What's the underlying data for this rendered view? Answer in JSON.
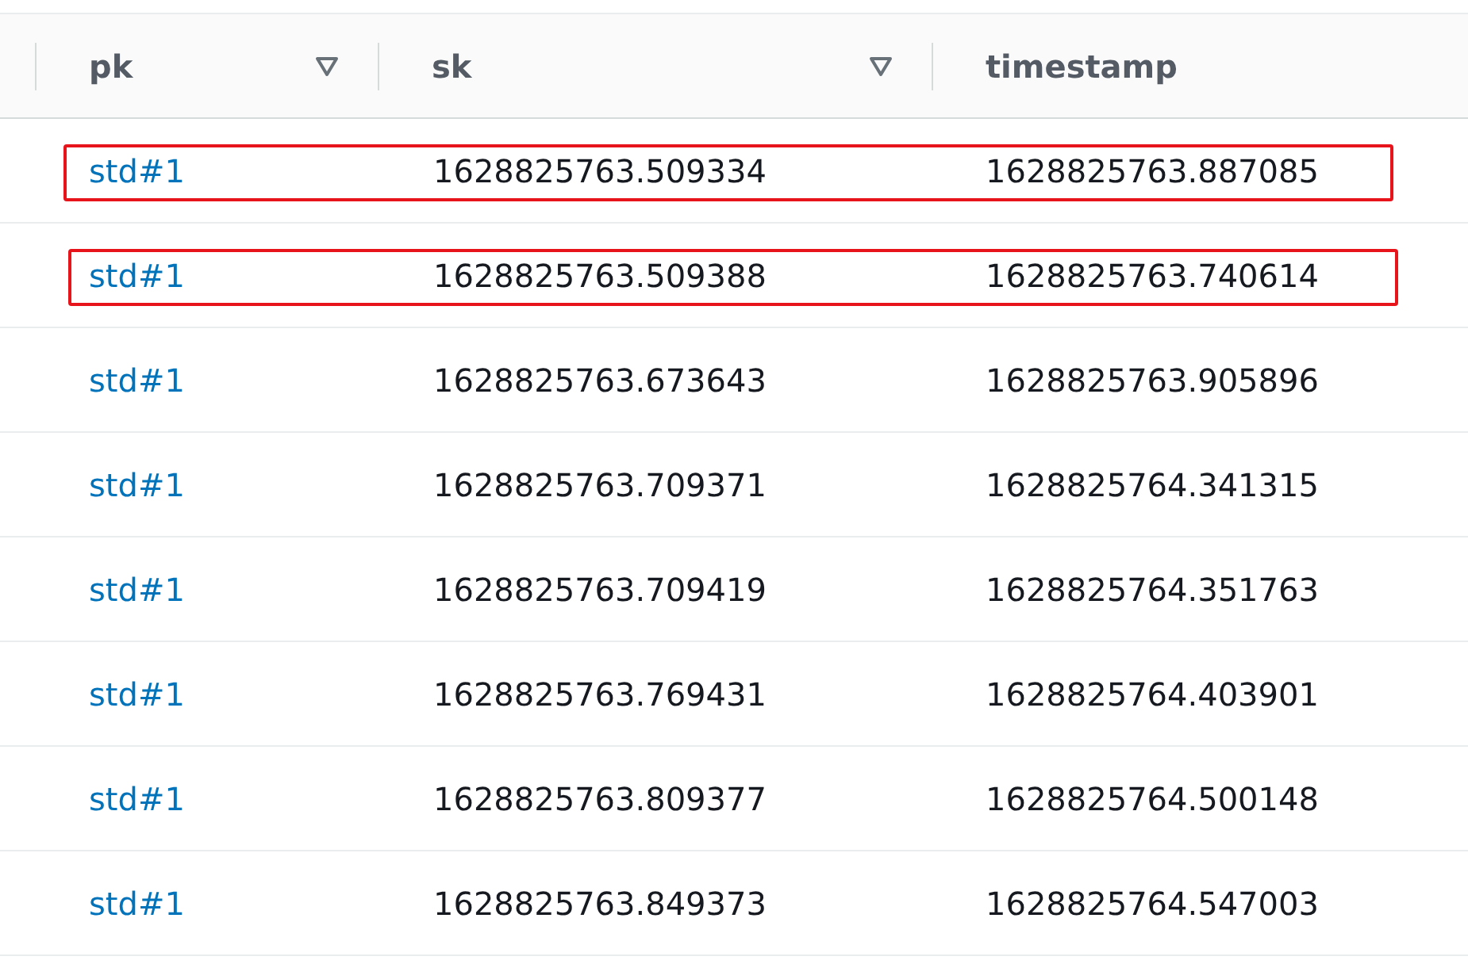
{
  "table": {
    "columns": [
      {
        "label": "pk",
        "sort_icon": true
      },
      {
        "label": "sk",
        "sort_icon": true
      },
      {
        "label": "timestamp",
        "sort_icon": false
      }
    ],
    "rows": [
      {
        "pk": "std#1",
        "sk": "1628825763.509334",
        "timestamp": "1628825763.887085",
        "highlighted": true
      },
      {
        "pk": "std#1",
        "sk": "1628825763.509388",
        "timestamp": "1628825763.740614",
        "highlighted": true
      },
      {
        "pk": "std#1",
        "sk": "1628825763.673643",
        "timestamp": "1628825763.905896",
        "highlighted": false
      },
      {
        "pk": "std#1",
        "sk": "1628825763.709371",
        "timestamp": "1628825764.341315",
        "highlighted": false
      },
      {
        "pk": "std#1",
        "sk": "1628825763.709419",
        "timestamp": "1628825764.351763",
        "highlighted": false
      },
      {
        "pk": "std#1",
        "sk": "1628825763.769431",
        "timestamp": "1628825764.403901",
        "highlighted": false
      },
      {
        "pk": "std#1",
        "sk": "1628825763.809377",
        "timestamp": "1628825764.500148",
        "highlighted": false
      },
      {
        "pk": "std#1",
        "sk": "1628825763.849373",
        "timestamp": "1628825764.547003",
        "highlighted": false
      }
    ]
  }
}
